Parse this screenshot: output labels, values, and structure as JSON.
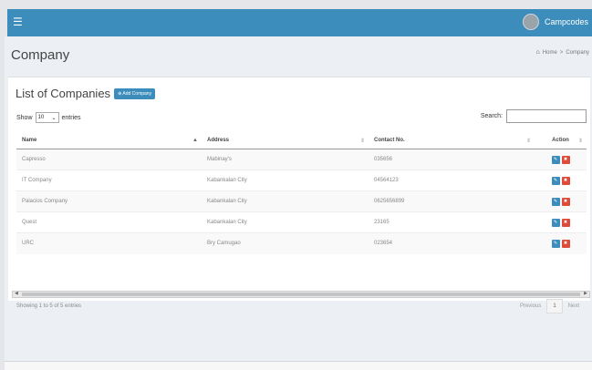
{
  "header": {
    "menu_icon": "hamburger-icon",
    "user_name": "Campcodes"
  },
  "page": {
    "title": "Company"
  },
  "breadcrumb": {
    "home": "Home",
    "sep": ">",
    "current": "Company"
  },
  "box": {
    "title": "List of Companies",
    "add_label": "Add Company"
  },
  "controls": {
    "show_label": "Show",
    "entries_value": "10",
    "entries_label": "entries",
    "search_label": "Search:"
  },
  "table": {
    "columns": [
      "Name",
      "Address",
      "Contact No.",
      "Action"
    ],
    "rows": [
      [
        "Capresso",
        "Mabinay's",
        "035656"
      ],
      [
        "IT Company",
        "Kabankalan City",
        "04564123"
      ],
      [
        "Palacios Company",
        "Kabankalan City",
        "0625656899"
      ],
      [
        "Quest",
        "Kabankalan City",
        "23165"
      ],
      [
        "URC",
        "Bry Camugao",
        "023654"
      ]
    ]
  },
  "footer": {
    "info": "Showing 1 to 5 of 5 entries",
    "prev": "Previous",
    "page": "1",
    "next": "Next"
  },
  "colors": {
    "primary": "#3c8dbc",
    "danger": "#dd4b39"
  }
}
